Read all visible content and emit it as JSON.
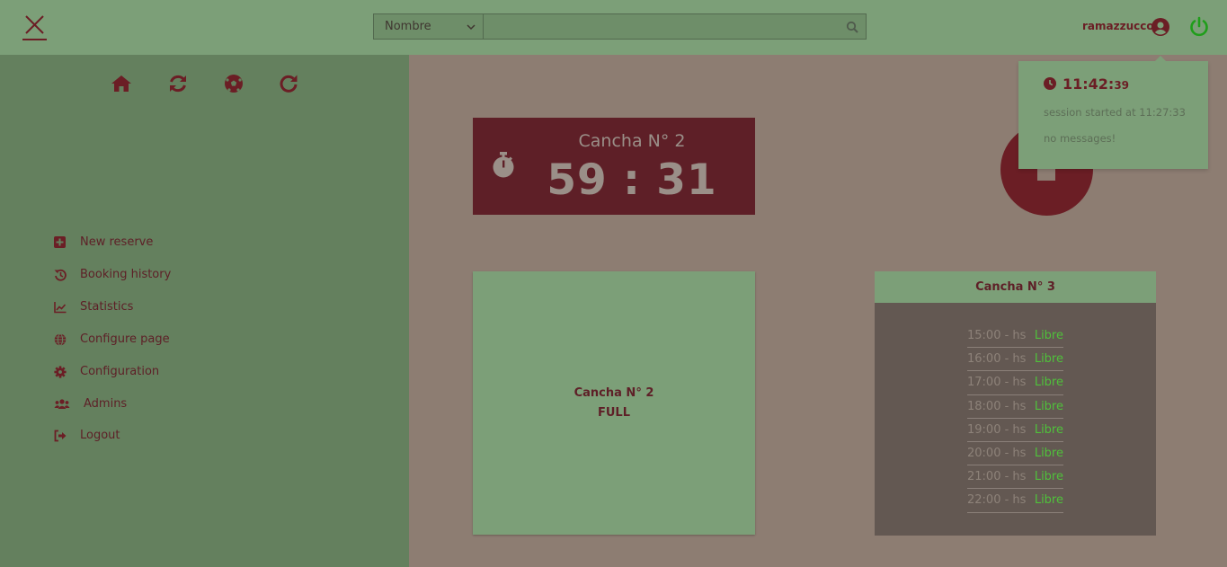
{
  "header": {
    "search": {
      "select_value": "Nombre",
      "placeholder": ""
    },
    "username": "ramazzucco"
  },
  "sidebar": {
    "quick_icons": [
      "home-icon",
      "sync-icon",
      "soccer-ball-icon",
      "redo-icon"
    ],
    "menu": [
      {
        "label": "New reserve",
        "icon": "plus-square-icon"
      },
      {
        "label": "Booking history",
        "icon": "history-icon"
      },
      {
        "label": "Statistics",
        "icon": "line-chart-icon"
      },
      {
        "label": "Configure page",
        "icon": "globe-icon"
      },
      {
        "label": "Configuration",
        "icon": "gear-icon"
      },
      {
        "label": "Admins",
        "icon": "users-icon"
      },
      {
        "label": "Logout",
        "icon": "sign-out-icon"
      }
    ]
  },
  "timer": {
    "title": "Cancha N° 2",
    "time": "59 : 31"
  },
  "notification": {
    "time_main": "11:42:",
    "time_seconds": "39",
    "session": "session started at 11:27:33",
    "messages": "no messages!"
  },
  "court_full": {
    "title": "Cancha N° 2",
    "status": "FULL"
  },
  "court_schedule": {
    "title": "Cancha N° 3",
    "slots": [
      {
        "time": "15:00 - hs",
        "status": "Libre"
      },
      {
        "time": "16:00 - hs",
        "status": "Libre"
      },
      {
        "time": "17:00 - hs",
        "status": "Libre"
      },
      {
        "time": "18:00 - hs",
        "status": "Libre"
      },
      {
        "time": "19:00 - hs",
        "status": "Libre"
      },
      {
        "time": "20:00 - hs",
        "status": "Libre"
      },
      {
        "time": "21:00 - hs",
        "status": "Libre"
      },
      {
        "time": "22:00 - hs",
        "status": "Libre"
      }
    ]
  },
  "colors": {
    "header_bg": "#7c9f78",
    "sidebar_bg": "#64805e",
    "main_bg": "#8d7d72",
    "accent": "#5e1f27",
    "power": "#1f9e1a",
    "free_status": "#4fc13b"
  }
}
